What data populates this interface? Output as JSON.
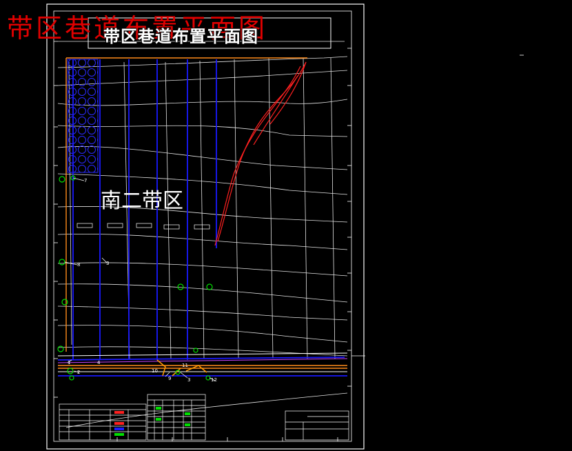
{
  "drawing": {
    "overlay_title": "带区巷道布置平面图",
    "frame_title": "带区巷道布置平面图",
    "zone_label": "南二带区",
    "point_labels": [
      "7",
      "8",
      "3",
      "2",
      "1",
      "4",
      "10",
      "9",
      "11",
      "12",
      "3"
    ]
  },
  "colors": {
    "background": "#000000",
    "overlay_title": "#e00000",
    "frame": "#ffffff",
    "roadway": "#1a1aff",
    "contour": "#ffffff",
    "fault": "#ff2020",
    "boundary": "#ff8c1a",
    "marker": "#00e000",
    "conveyor": "#ff9900"
  }
}
